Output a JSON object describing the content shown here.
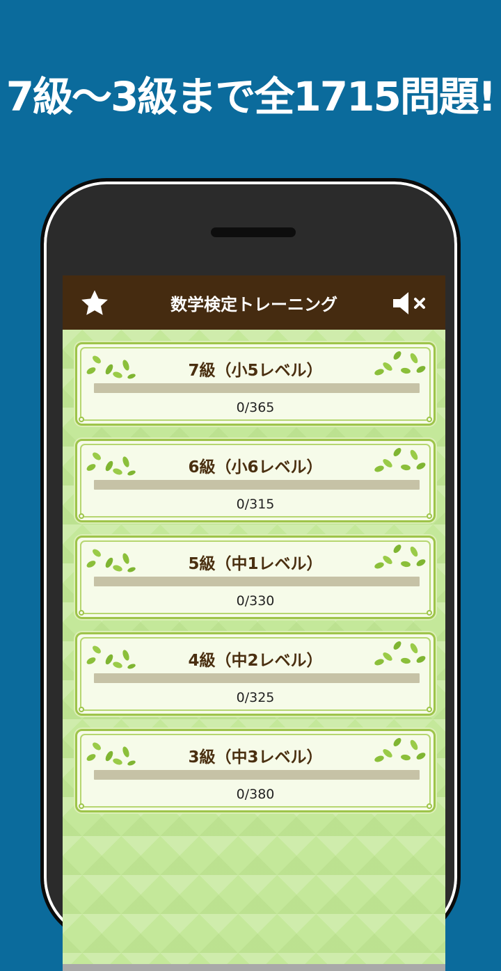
{
  "headline": "7級〜3級まで全1715問題!",
  "app": {
    "title": "数学検定トレーニング",
    "icons": {
      "favorites": "star-icon",
      "sound": "speaker-muted-icon"
    }
  },
  "colors": {
    "background": "#0b6b9c",
    "appbar": "#452b10",
    "card_border": "#9ec44a",
    "progress_track": "#c6c2a6",
    "progress_fill": "#8bbf3a"
  },
  "levels": [
    {
      "title": "7級（小5レベル）",
      "count": "0/365",
      "progress": 0
    },
    {
      "title": "6級（小6レベル）",
      "count": "0/315",
      "progress": 0
    },
    {
      "title": "5級（中1レベル）",
      "count": "0/330",
      "progress": 0
    },
    {
      "title": "4級（中2レベル）",
      "count": "0/325",
      "progress": 0
    },
    {
      "title": "3級（中3レベル）",
      "count": "0/380",
      "progress": 0
    }
  ]
}
